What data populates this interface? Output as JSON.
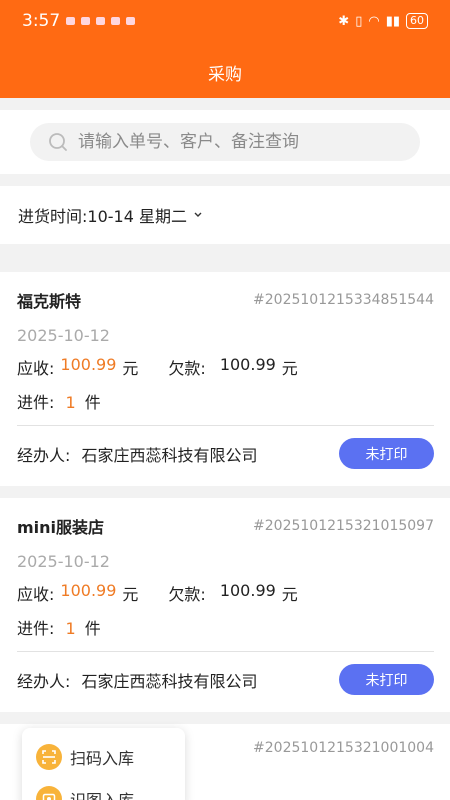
{
  "status_bar": {
    "time": "3:57",
    "battery": "60"
  },
  "header": {
    "title": "采购"
  },
  "search": {
    "placeholder": "请输入单号、客户、备注查询"
  },
  "date_filter": {
    "label": "进货时间:10-14 星期二"
  },
  "labels": {
    "receivable": "应收:",
    "owed": "欠款:",
    "qty": "进件:",
    "unit_yuan": "元",
    "unit_piece": "件",
    "handler": "经办人:"
  },
  "orders": [
    {
      "customer": "福克斯特",
      "order_no": "#2025101215334851544",
      "date": "2025-10-12",
      "receivable": "100.99",
      "owed": "100.99",
      "qty": "1",
      "handler": "石家庄西蕊科技有限公司",
      "print_status": "未打印"
    },
    {
      "customer": "mini服装店",
      "order_no": "#2025101215321015097",
      "date": "2025-10-12",
      "receivable": "100.99",
      "owed": "100.99",
      "qty": "1",
      "handler": "石家庄西蕊科技有限公司",
      "print_status": "未打印"
    },
    {
      "order_no": "#2025101215321001004"
    }
  ],
  "float_menu": {
    "items": [
      {
        "label": "扫码入库"
      },
      {
        "label": "识图入库"
      }
    ]
  },
  "colors": {
    "header": "#ff6a13",
    "accent_orange": "#ef7b25",
    "button_blue": "#5b71f2"
  }
}
